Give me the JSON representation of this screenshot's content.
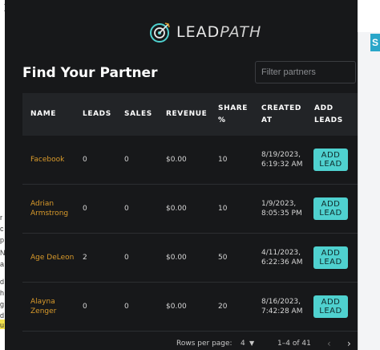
{
  "background": {
    "close_glyph": "✕",
    "close_right_glyph": "✕",
    "right_button_label": "S",
    "left_fragments": [
      "r",
      "c",
      "p",
      "N",
      "a",
      "d",
      "h",
      "g",
      "d",
      "u"
    ]
  },
  "modal": {
    "logo": {
      "icon": "target-arrow-icon",
      "text_bold": "LEAD",
      "text_italic": "PATH"
    },
    "title": "Find Your Partner",
    "filter_placeholder": "Filter partners",
    "columns": [
      "NAME",
      "LEADS",
      "SALES",
      "REVENUE",
      "SHARE %",
      "CREATED AT",
      "ADD LEADS"
    ],
    "rows": [
      {
        "name": "Facebook",
        "leads": "0",
        "sales": "0",
        "revenue": "$0.00",
        "share": "10",
        "created": "8/19/2023, 6:19:32 AM",
        "action": "ADD LEAD"
      },
      {
        "name": "Adrian Armstrong",
        "leads": "0",
        "sales": "0",
        "revenue": "$0.00",
        "share": "10",
        "created": "1/9/2023, 8:05:35 PM",
        "action": "ADD LEAD"
      },
      {
        "name": "Age DeLeon",
        "leads": "2",
        "sales": "0",
        "revenue": "$0.00",
        "share": "50",
        "created": "4/11/2023, 6:22:36 AM",
        "action": "ADD LEAD"
      },
      {
        "name": "Alayna Zenger",
        "leads": "0",
        "sales": "0",
        "revenue": "$0.00",
        "share": "20",
        "created": "8/16/2023, 7:42:28 AM",
        "action": "ADD LEAD"
      }
    ],
    "pagination": {
      "rows_per_page_label": "Rows per page:",
      "rows_per_page_value": "4",
      "range": "1–4 of 41"
    }
  },
  "colors": {
    "accent": "#4fd1cf",
    "name_link": "#d99a2b",
    "modal_bg": "#17181a"
  }
}
